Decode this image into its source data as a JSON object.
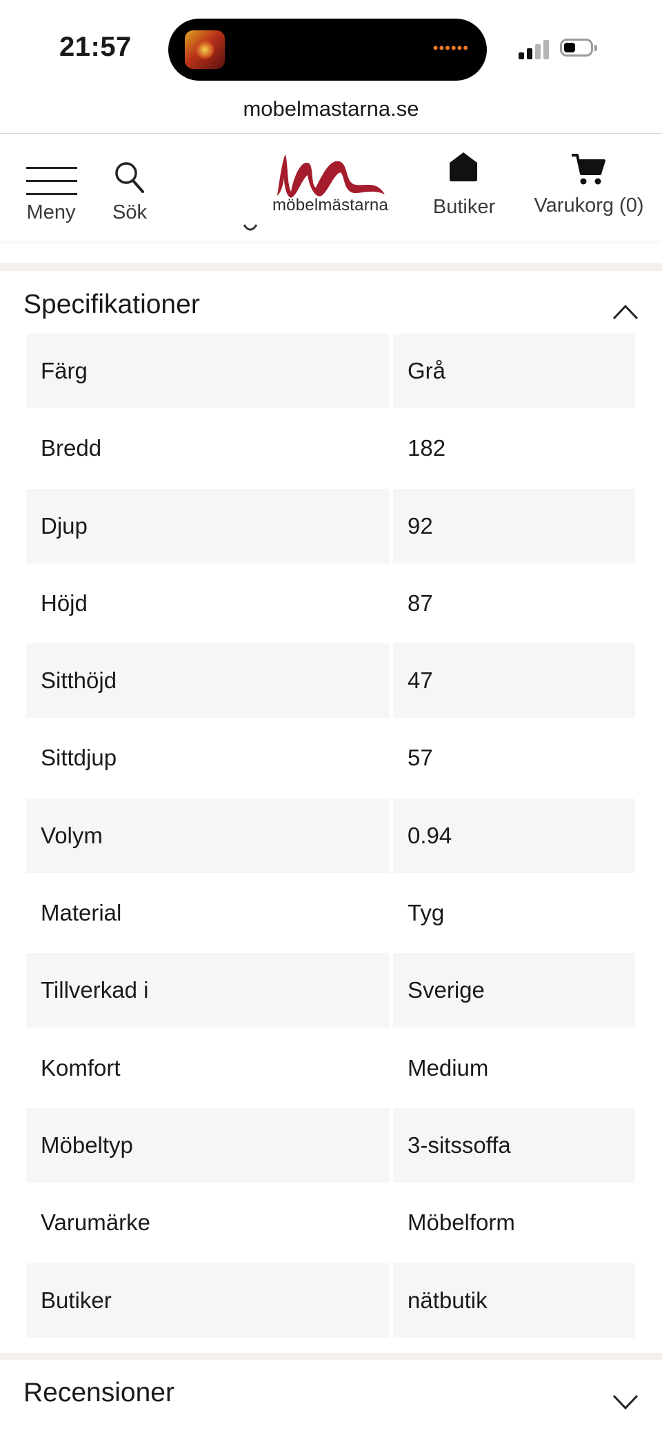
{
  "status_bar": {
    "time": "21:57"
  },
  "browser": {
    "url": "mobelmastarna.se"
  },
  "header": {
    "menu_label": "Meny",
    "search_label": "Sök",
    "logo_text": "möbelmästarna",
    "stores_label": "Butiker",
    "cart_label": "Varukorg (0)",
    "brand_color": "#a51d2d"
  },
  "specs": {
    "title": "Specifikationer",
    "rows": [
      {
        "key": "Färg",
        "value": "Grå"
      },
      {
        "key": "Bredd",
        "value": "182"
      },
      {
        "key": "Djup",
        "value": "92"
      },
      {
        "key": "Höjd",
        "value": "87"
      },
      {
        "key": "Sitthöjd",
        "value": "47"
      },
      {
        "key": "Sittdjup",
        "value": "57"
      },
      {
        "key": "Volym",
        "value": "0.94"
      },
      {
        "key": "Material",
        "value": "Tyg"
      },
      {
        "key": "Tillverkad i",
        "value": "Sverige"
      },
      {
        "key": "Komfort",
        "value": "Medium"
      },
      {
        "key": "Möbeltyp",
        "value": "3-sitssoffa"
      },
      {
        "key": "Varumärke",
        "value": "Möbelform"
      },
      {
        "key": "Butiker",
        "value": "nätbutik"
      }
    ]
  },
  "reviews": {
    "title": "Recensioner"
  }
}
